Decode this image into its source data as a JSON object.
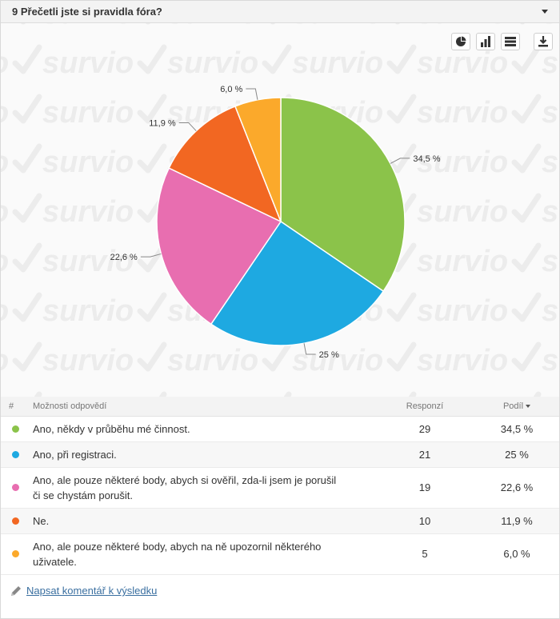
{
  "header": {
    "title": "9 Přečetli jste si pravidla fóra?"
  },
  "toolbar": {
    "icons": [
      "pie-chart-icon",
      "bar-chart-icon",
      "table-view-icon",
      "download-icon"
    ]
  },
  "watermark_text": "survio",
  "chart_data": {
    "type": "pie",
    "categories": [
      "Ano, někdy v průběhu mé činnost.",
      "Ano, při registraci.",
      "Ano, ale pouze některé body, abych si ověřil, zda-li jsem je porušil či se chystám porušit.",
      "Ne.",
      "Ano, ale pouze některé body, abych na ně upozornil některého uživatele."
    ],
    "values": [
      34.5,
      25,
      22.6,
      11.9,
      6.0
    ],
    "labels": [
      "34,5 %",
      "25 %",
      "22,6 %",
      "11,9 %",
      "6,0 %"
    ],
    "colors": [
      "#8bc34a",
      "#1ea9e1",
      "#e86eb0",
      "#f26722",
      "#fba92b"
    ]
  },
  "table": {
    "headers": {
      "hash": "#",
      "option": "Možnosti odpovědí",
      "responses": "Responzí",
      "share": "Podíl"
    },
    "rows": [
      {
        "color": "#8bc34a",
        "option": "Ano, někdy v průběhu mé činnost.",
        "responses": "29",
        "share": "34,5 %"
      },
      {
        "color": "#1ea9e1",
        "option": "Ano, při registraci.",
        "responses": "21",
        "share": "25 %"
      },
      {
        "color": "#e86eb0",
        "option": "Ano, ale pouze některé body, abych si ověřil, zda-li jsem je porušil či se chystám porušit.",
        "responses": "19",
        "share": "22,6 %"
      },
      {
        "color": "#f26722",
        "option": "Ne.",
        "responses": "10",
        "share": "11,9 %"
      },
      {
        "color": "#fba92b",
        "option": "Ano, ale pouze některé body, abych na ně upozornil některého uživatele.",
        "responses": "5",
        "share": "6,0 %"
      }
    ]
  },
  "footer": {
    "comment_link": "Napsat komentář k výsledku"
  }
}
